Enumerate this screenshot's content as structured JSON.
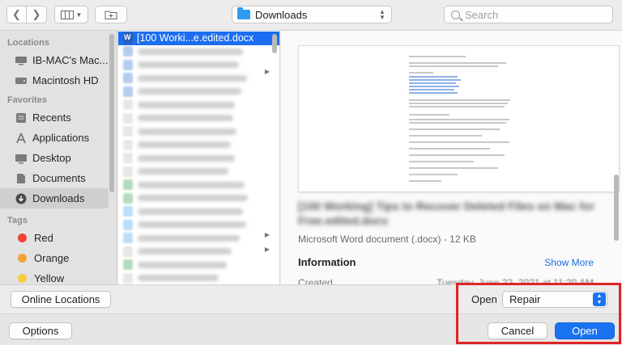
{
  "toolbar": {
    "location": "Downloads",
    "search_placeholder": "Search"
  },
  "sidebar": {
    "locations_title": "Locations",
    "locations": [
      "IB-MAC's Mac...",
      "Macintosh HD"
    ],
    "favorites_title": "Favorites",
    "favorites": [
      {
        "label": "Recents",
        "icon": "clock-icon"
      },
      {
        "label": "Applications",
        "icon": "applications-icon"
      },
      {
        "label": "Desktop",
        "icon": "desktop-icon"
      },
      {
        "label": "Documents",
        "icon": "documents-icon"
      },
      {
        "label": "Downloads",
        "icon": "downloads-icon",
        "active": true
      }
    ],
    "tags_title": "Tags",
    "tags": [
      {
        "label": "Red",
        "color": "#f0443a"
      },
      {
        "label": "Orange",
        "color": "#f5a135"
      },
      {
        "label": "Yellow",
        "color": "#f4cd3e"
      }
    ]
  },
  "files": {
    "selected": "[100 Worki...e.edited.docx"
  },
  "preview": {
    "title": "[100 Working] Tips to Recover Deleted Files on Mac for Free.edited.docx",
    "kind": "Microsoft Word document (.docx) - 12 KB",
    "info_heading": "Information",
    "show_more": "Show More",
    "created_label": "Created",
    "created_value": "Tuesday, June 22, 2021 at 11:20 AM"
  },
  "bottom": {
    "online_locations": "Online Locations",
    "open_label": "Open",
    "open_with": "Repair",
    "options": "Options",
    "cancel": "Cancel",
    "open": "Open"
  },
  "colors": {
    "accent": "#1a73f0",
    "highlight": "#e02424"
  }
}
